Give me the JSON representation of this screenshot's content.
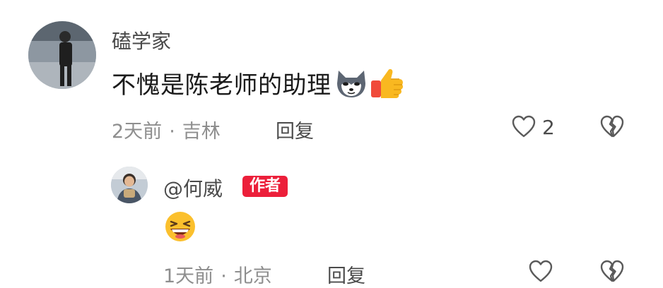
{
  "comment": {
    "username": "磕学家",
    "text": "不愧是陈老师的助理",
    "time": "2天前",
    "location": "吉林",
    "reply_label": "回复",
    "like_count": "2"
  },
  "reply": {
    "username": "@何威",
    "badge": "作者",
    "time": "1天前",
    "location": "北京",
    "reply_label": "回复"
  },
  "separator": "·",
  "icons": {
    "emoji1": "wolf-face-emoji",
    "emoji2": "thumbs-up-emoji",
    "emoji3": "laughing-face-emoji",
    "like": "heart-outline-icon",
    "dislike": "broken-heart-icon"
  }
}
